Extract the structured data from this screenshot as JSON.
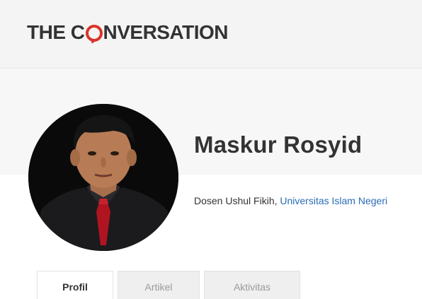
{
  "header": {
    "logo": {
      "part1": "THE C",
      "part2": "NVERSATION"
    }
  },
  "profile": {
    "name": "Maskur Rosyid",
    "role": "Dosen Ushul Fikih, ",
    "affiliation": "Universitas Islam Negeri"
  },
  "tabs": [
    {
      "label": "Profil",
      "active": true
    },
    {
      "label": "Artikel",
      "active": false
    },
    {
      "label": "Aktivitas",
      "active": false
    }
  ],
  "colors": {
    "brand": "#d8352a",
    "link": "#2a6bb5"
  },
  "icons": {
    "logo_o": "speech-bubble-icon"
  }
}
